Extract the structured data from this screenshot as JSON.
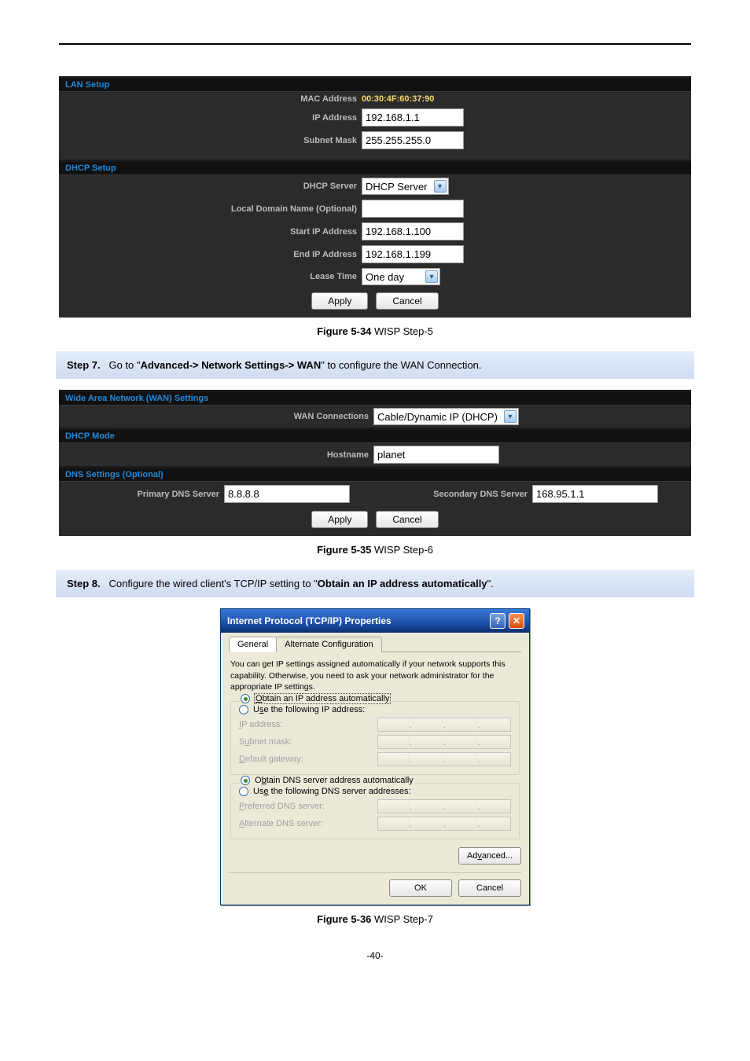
{
  "lan_setup": {
    "title": "LAN Setup",
    "mac_label": "MAC Address",
    "mac_value": "00:30:4F:60:37:90",
    "ip_label": "IP Address",
    "ip_value": "192.168.1.1",
    "mask_label": "Subnet Mask",
    "mask_value": "255.255.255.0"
  },
  "dhcp_setup": {
    "title": "DHCP Setup",
    "server_label": "DHCP Server",
    "server_value": "DHCP Server",
    "localdomain_label": "Local Domain Name (Optional)",
    "localdomain_value": "",
    "start_label": "Start IP Address",
    "start_value": "192.168.1.100",
    "end_label": "End IP Address",
    "end_value": "192.168.1.199",
    "lease_label": "Lease Time",
    "lease_value": "One day",
    "apply": "Apply",
    "cancel": "Cancel"
  },
  "caption1": {
    "bold": "Figure 5-34",
    "rest": " WISP Step-5"
  },
  "step7_prefix": "Step 7.",
  "step7_a": "Go to \"",
  "step7_b": "Advanced-> Network Settings-> WAN",
  "step7_c": "\" to configure the WAN Connection.",
  "wan": {
    "title": "Wide Area Network (WAN) Settings",
    "conn_label": "WAN Connections",
    "conn_value": "Cable/Dynamic IP (DHCP)",
    "dhcp_title": "DHCP Mode",
    "host_label": "Hostname",
    "host_value": "planet",
    "dns_title": "DNS Settings (Optional)",
    "pri_label": "Primary DNS Server",
    "pri_value": "8.8.8.8",
    "sec_label": "Secondary DNS Server",
    "sec_value": "168.95.1.1",
    "apply": "Apply",
    "cancel": "Cancel"
  },
  "caption2": {
    "bold": "Figure 5-35",
    "rest": " WISP Step-6"
  },
  "step8_prefix": "Step 8.",
  "step8_a": "Configure the wired client's TCP/IP setting to \"",
  "step8_b": "Obtain an IP address automatically",
  "step8_c": "\".",
  "tcpip": {
    "title": "Internet Protocol (TCP/IP) Properties",
    "tab_general": "General",
    "tab_alt": "Alternate Configuration",
    "note": "You can get IP settings assigned automatically if your network supports this capability. Otherwise, you need to ask your network administrator for the appropriate IP settings.",
    "obtain_ip": "Obtain an IP address automatically",
    "use_ip": "Use the following IP address:",
    "ip_addr": "IP address:",
    "subnet": "Subnet mask:",
    "gateway": "Default gateway:",
    "obtain_dns": "Obtain DNS server address automatically",
    "use_dns": "Use the following DNS server addresses:",
    "pref_dns": "Preferred DNS server:",
    "alt_dns": "Alternate DNS server:",
    "advanced": "Advanced...",
    "ok": "OK",
    "cancel": "Cancel"
  },
  "caption3": {
    "bold": "Figure 5-36",
    "rest": " WISP Step-7"
  },
  "pagenum": "-40-"
}
